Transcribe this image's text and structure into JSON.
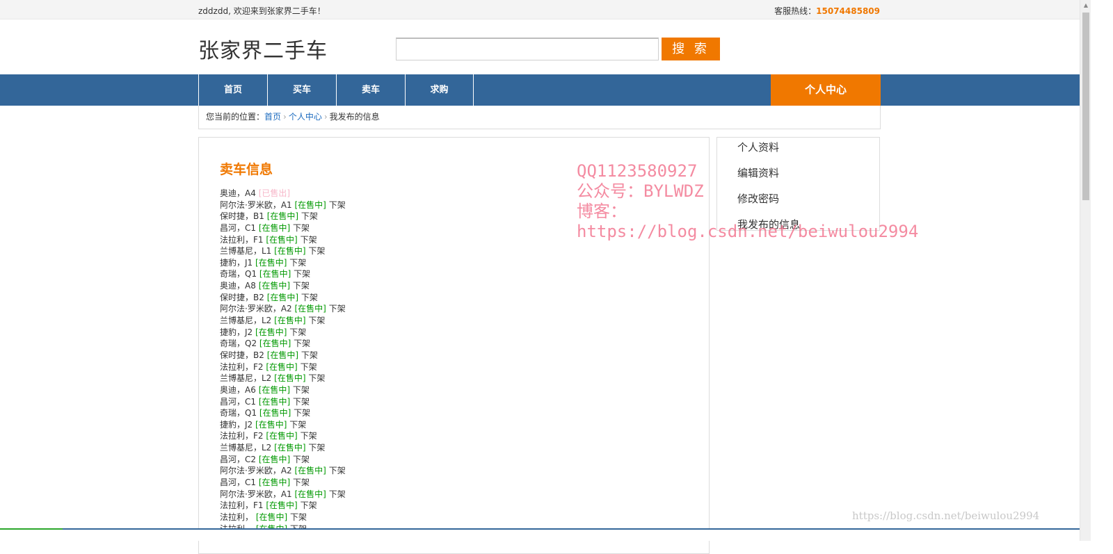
{
  "topbar": {
    "welcome": "zddzdd, 欢迎来到张家界二手车！",
    "hotline_label": "客服热线：",
    "hotline_number": "15074485809"
  },
  "header": {
    "logo": "张家界二手车",
    "search_value": "",
    "search_button": "搜 索"
  },
  "nav": {
    "items": [
      "首页",
      "买车",
      "卖车",
      "求购"
    ],
    "user_center": "个人中心"
  },
  "breadcrumb": {
    "prefix": "您当前的位置：",
    "home": "首页",
    "center": "个人中心",
    "current": "我发布的信息"
  },
  "main": {
    "title": "卖车信息",
    "delist_label": "下架",
    "items": [
      {
        "name": "奥迪，A4",
        "status": "[已售出]",
        "sold": true
      },
      {
        "name": "阿尔法·罗米欧，A1",
        "status": "[在售中]"
      },
      {
        "name": "保时捷，B1",
        "status": "[在售中]"
      },
      {
        "name": "昌河，C1",
        "status": "[在售中]"
      },
      {
        "name": "法拉利，F1",
        "status": "[在售中]"
      },
      {
        "name": "兰博基尼，L1",
        "status": "[在售中]"
      },
      {
        "name": "捷豹，J1",
        "status": "[在售中]"
      },
      {
        "name": "奇瑞，Q1",
        "status": "[在售中]"
      },
      {
        "name": "奥迪，A8",
        "status": "[在售中]"
      },
      {
        "name": "保时捷，B2",
        "status": "[在售中]"
      },
      {
        "name": "阿尔法·罗米欧，A2",
        "status": "[在售中]"
      },
      {
        "name": "兰博基尼，L2",
        "status": "[在售中]"
      },
      {
        "name": "捷豹，J2",
        "status": "[在售中]"
      },
      {
        "name": "奇瑞，Q2",
        "status": "[在售中]"
      },
      {
        "name": "保时捷，B2",
        "status": "[在售中]"
      },
      {
        "name": "法拉利，F2",
        "status": "[在售中]"
      },
      {
        "name": "兰博基尼，L2",
        "status": "[在售中]"
      },
      {
        "name": "奥迪，A6",
        "status": "[在售中]"
      },
      {
        "name": "昌河，C1",
        "status": "[在售中]"
      },
      {
        "name": "奇瑞，Q1",
        "status": "[在售中]"
      },
      {
        "name": "捷豹，J2",
        "status": "[在售中]"
      },
      {
        "name": "法拉利，F2",
        "status": "[在售中]"
      },
      {
        "name": "兰博基尼，L2",
        "status": "[在售中]"
      },
      {
        "name": "昌河，C2",
        "status": "[在售中]"
      },
      {
        "name": "阿尔法·罗米欧，A2",
        "status": "[在售中]"
      },
      {
        "name": "昌河，C1",
        "status": "[在售中]"
      },
      {
        "name": "阿尔法·罗米欧，A1",
        "status": "[在售中]"
      },
      {
        "name": "法拉利，F1",
        "status": "[在售中]"
      },
      {
        "name": "法拉利，",
        "status": "[在售中]"
      },
      {
        "name": "法拉利，",
        "status": "[在售中]"
      }
    ]
  },
  "sidebar": {
    "items": [
      "个人资料",
      "编辑资料",
      "修改密码",
      "我发布的信息"
    ]
  },
  "watermark": {
    "lines": [
      "QQ1123580927",
      "公众号：BYLWDZ",
      "博客：",
      "https://blog.csdn.net/beiwulou2994"
    ],
    "corner": "https://blog.csdn.net/beiwulou2994"
  },
  "colors": {
    "accent": "#f07800",
    "nav": "#336699",
    "link": "#1c6bbf",
    "on_sale": "#009900",
    "sold": "#f7b6c8"
  }
}
